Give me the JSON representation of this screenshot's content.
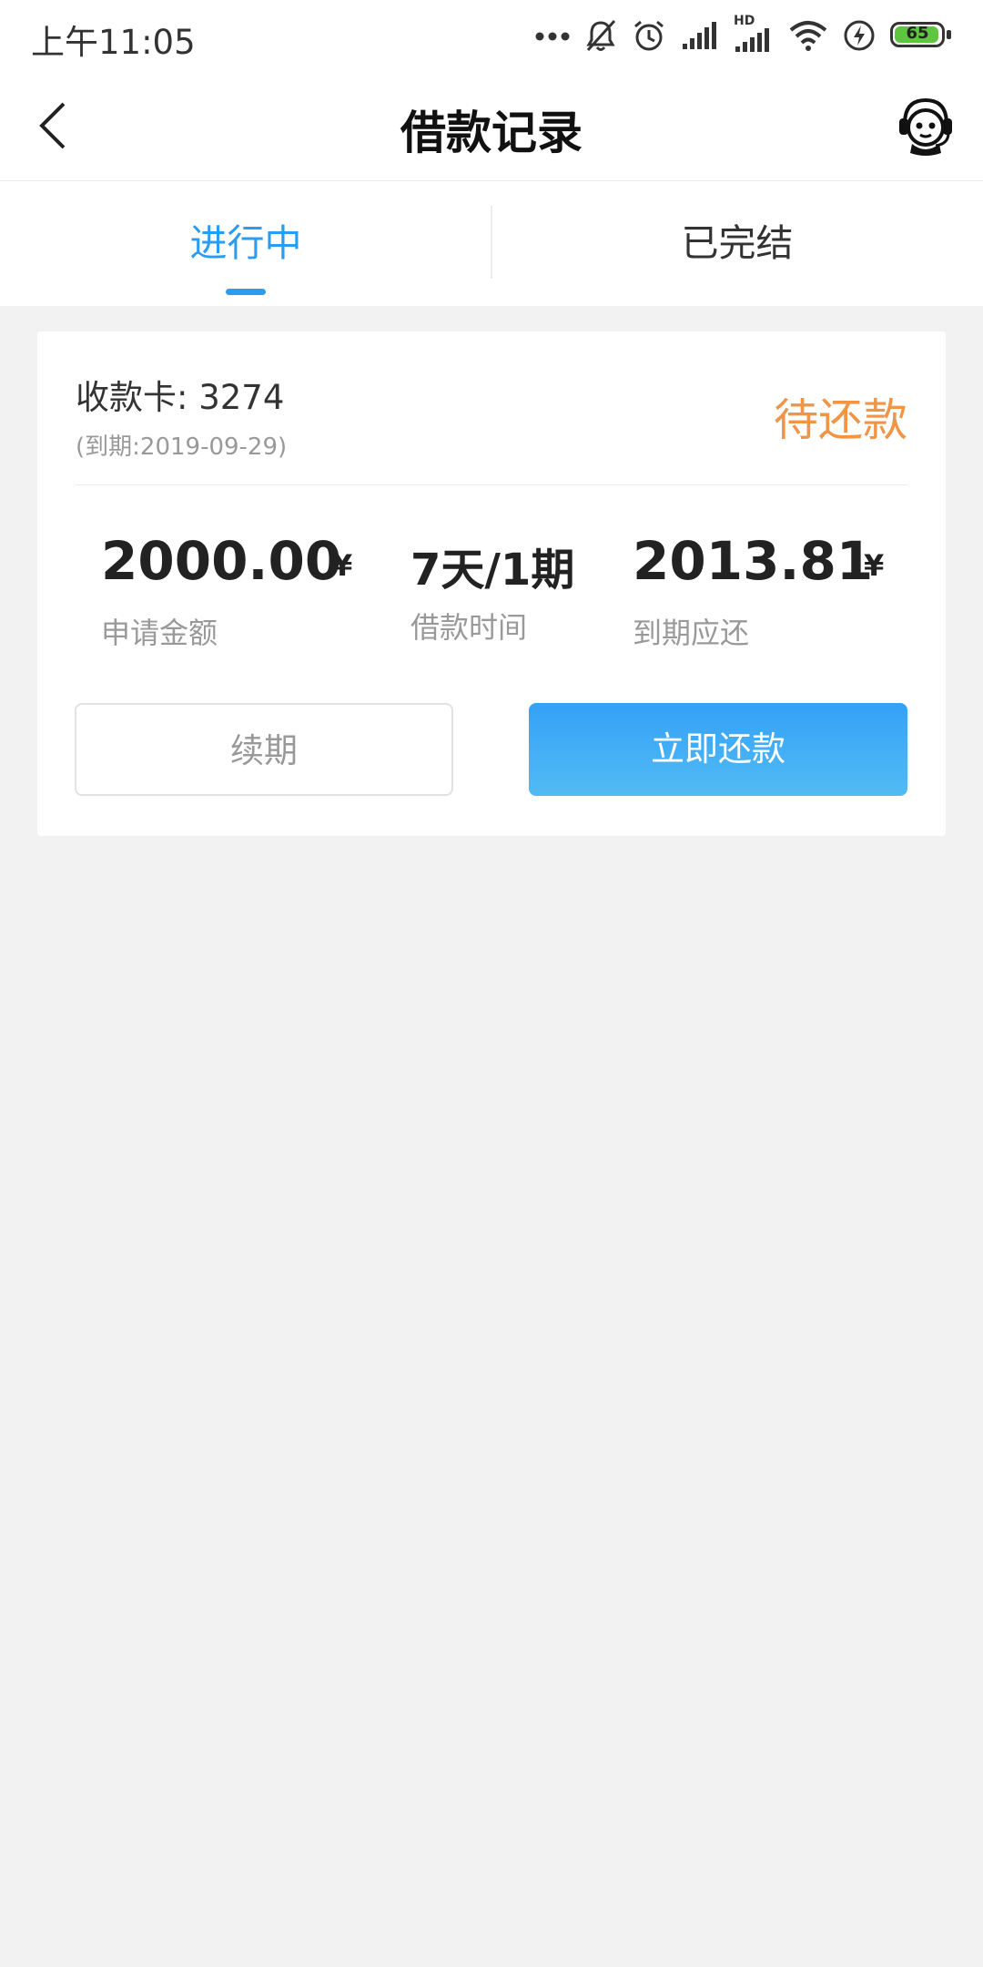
{
  "status_bar": {
    "time": "上午11:05",
    "icons": [
      "more-dots-icon",
      "mute-icon",
      "alarm-icon",
      "signal-icon",
      "hd-signal-icon",
      "wifi-icon",
      "charging-icon",
      "battery-icon"
    ],
    "hd_label": "HD",
    "battery": "65"
  },
  "nav": {
    "title": "借款记录",
    "back_icon": "chevron-left-icon",
    "service_icon": "customer-service-icon"
  },
  "tabs": [
    {
      "label": "进行中",
      "active": true
    },
    {
      "label": "已完结",
      "active": false
    }
  ],
  "loan_card": {
    "card_label": "收款卡: 3274",
    "due_date": "(到期:2019-09-29)",
    "status": "待还款",
    "amount": "2000.00",
    "amount_currency": "¥",
    "amount_label": "申请金额",
    "term": "7天/1期",
    "term_label": "借款时间",
    "repay_amount": "2013.81",
    "repay_currency": "¥",
    "repay_label": "到期应还",
    "renew_label": "续期",
    "repay_label_btn": "立即还款"
  },
  "colors": {
    "accent": "#2b9cf2",
    "status_orange": "#f09546",
    "background": "#f2f2f2",
    "battery_green": "#5ec53f"
  }
}
